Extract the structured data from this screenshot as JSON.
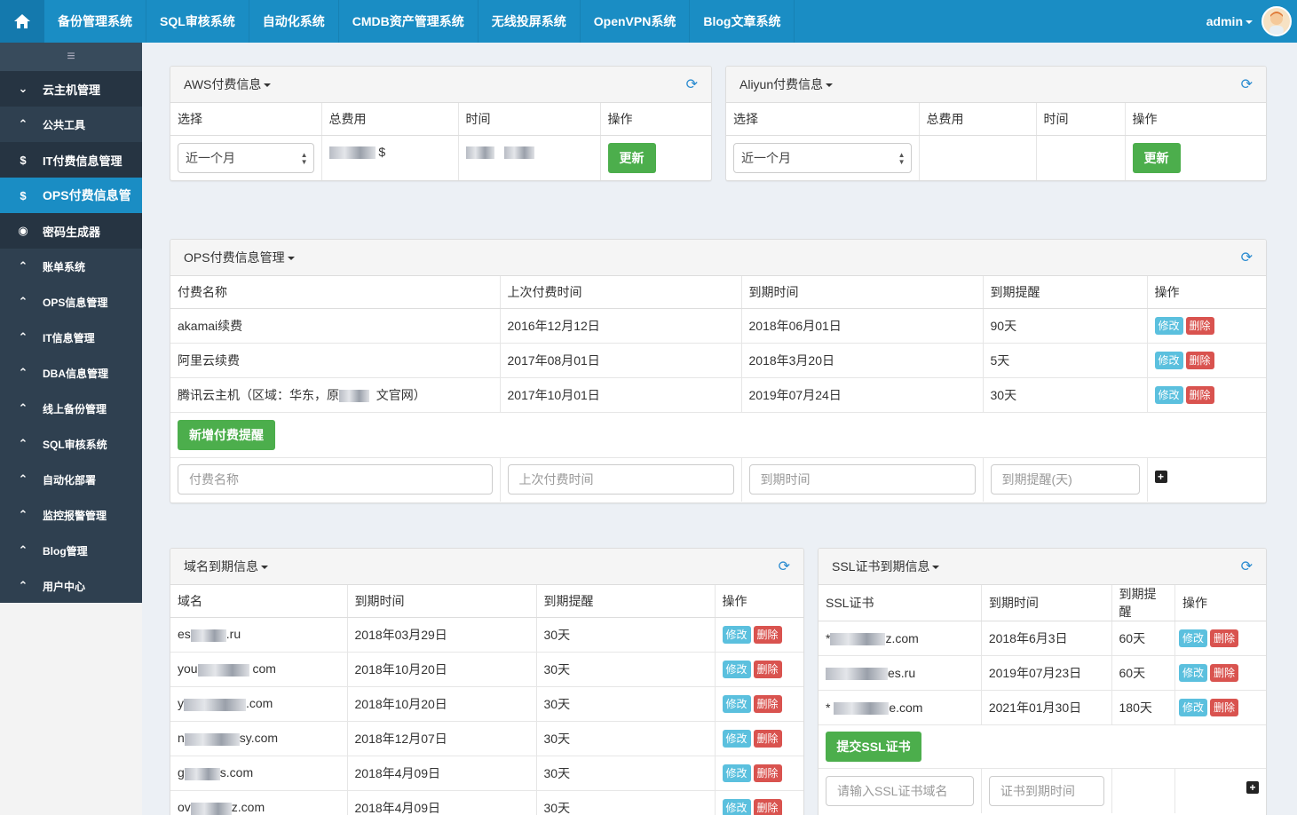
{
  "nav": {
    "items": [
      "备份管理系统",
      "SQL审核系统",
      "自动化系统",
      "CMDB资产管理系统",
      "无线投屏系统",
      "OpenVPN系统",
      "Blog文章系统"
    ],
    "user": "admin"
  },
  "sidebar": {
    "toggle": "≡",
    "items": [
      {
        "label": "云主机管理",
        "icon": "chevron-down-icon"
      },
      {
        "label": "公共工具",
        "icon": "chevron-up-icon"
      },
      {
        "label": "IT付费信息管理",
        "icon": "dollar-icon"
      },
      {
        "label": "OPS付费信息管",
        "icon": "dollar-icon"
      },
      {
        "label": "密码生成器",
        "icon": "eye-icon"
      },
      {
        "label": "账单系统",
        "icon": "chevron-up-icon"
      },
      {
        "label": "OPS信息管理",
        "icon": "chevron-up-icon"
      },
      {
        "label": "IT信息管理",
        "icon": "chevron-up-icon"
      },
      {
        "label": "DBA信息管理",
        "icon": "chevron-up-icon"
      },
      {
        "label": "线上备份管理",
        "icon": "chevron-up-icon"
      },
      {
        "label": "SQL审核系统",
        "icon": "chevron-up-icon"
      },
      {
        "label": "自动化部署",
        "icon": "chevron-up-icon"
      },
      {
        "label": "监控报警管理",
        "icon": "chevron-up-icon"
      },
      {
        "label": "Blog管理",
        "icon": "chevron-up-icon"
      },
      {
        "label": "用户中心",
        "icon": "chevron-up-icon"
      }
    ]
  },
  "aws": {
    "title": "AWS付费信息",
    "headers": [
      "选择",
      "总费用",
      "时间",
      "操作"
    ],
    "select_value": "近一个月",
    "cost_suffix": "$",
    "update_label": "更新"
  },
  "aliyun": {
    "title": "Aliyun付费信息",
    "headers": [
      "选择",
      "总费用",
      "时间",
      "操作"
    ],
    "select_value": "近一个月",
    "update_label": "更新"
  },
  "ops": {
    "title": "OPS付费信息管理",
    "headers": [
      "付费名称",
      "上次付费时间",
      "到期时间",
      "到期提醒",
      "操作"
    ],
    "rows": [
      {
        "name": "akamai续费",
        "last": "2016年12月12日",
        "expire": "2018年06月01日",
        "remind": "90天"
      },
      {
        "name": "阿里云续费",
        "last": "2017年08月01日",
        "expire": "2018年3月20日",
        "remind": "5天"
      },
      {
        "name_a": "腾讯云主机（区域：华东，原",
        "name_b": "文官网）",
        "last": "2017年10月01日",
        "expire": "2019年07月24日",
        "remind": "30天"
      }
    ],
    "add_label": "新增付费提醒",
    "placeholders": [
      "付费名称",
      "上次付费时间",
      "到期时间",
      "到期提醒(天)"
    ],
    "edit_label": "修改",
    "delete_label": "删除"
  },
  "domain": {
    "title": "域名到期信息",
    "headers": [
      "域名",
      "到期时间",
      "到期提醒",
      "操作"
    ],
    "rows": [
      {
        "a": "es",
        "b": ".ru",
        "expire": "2018年03月29日",
        "remind": "30天"
      },
      {
        "a": "you",
        "b": "com",
        "expire": "2018年10月20日",
        "remind": "30天"
      },
      {
        "a": "y",
        "b": ".com",
        "expire": "2018年10月20日",
        "remind": "30天"
      },
      {
        "a": "n",
        "b": "sy.com",
        "expire": "2018年12月07日",
        "remind": "30天"
      },
      {
        "a": "g",
        "b": "s.com",
        "expire": "2018年4月09日",
        "remind": "30天"
      },
      {
        "a": "ov",
        "b": "z.com",
        "expire": "2018年4月09日",
        "remind": "30天"
      }
    ]
  },
  "ssl": {
    "title": "SSL证书到期信息",
    "headers": [
      "SSL证书",
      "到期时间",
      "到期提醒",
      "操作"
    ],
    "rows": [
      {
        "a": "*",
        "b": "z.com",
        "expire": "2018年6月3日",
        "remind": "60天"
      },
      {
        "a": "",
        "b": "es.ru",
        "expire": "2019年07月23日",
        "remind": "60天"
      },
      {
        "a": "*",
        "b": "e.com",
        "expire": "2021年01月30日",
        "remind": "180天"
      }
    ],
    "submit_label": "提交SSL证书",
    "placeholders": [
      "请输入SSL证书域名",
      "证书到期时间"
    ]
  },
  "colors": {
    "nav": "#1a8dc4",
    "sidebar": "#2f4050",
    "green": "#4cae4c",
    "info": "#5bc0de",
    "danger": "#d9534f"
  }
}
